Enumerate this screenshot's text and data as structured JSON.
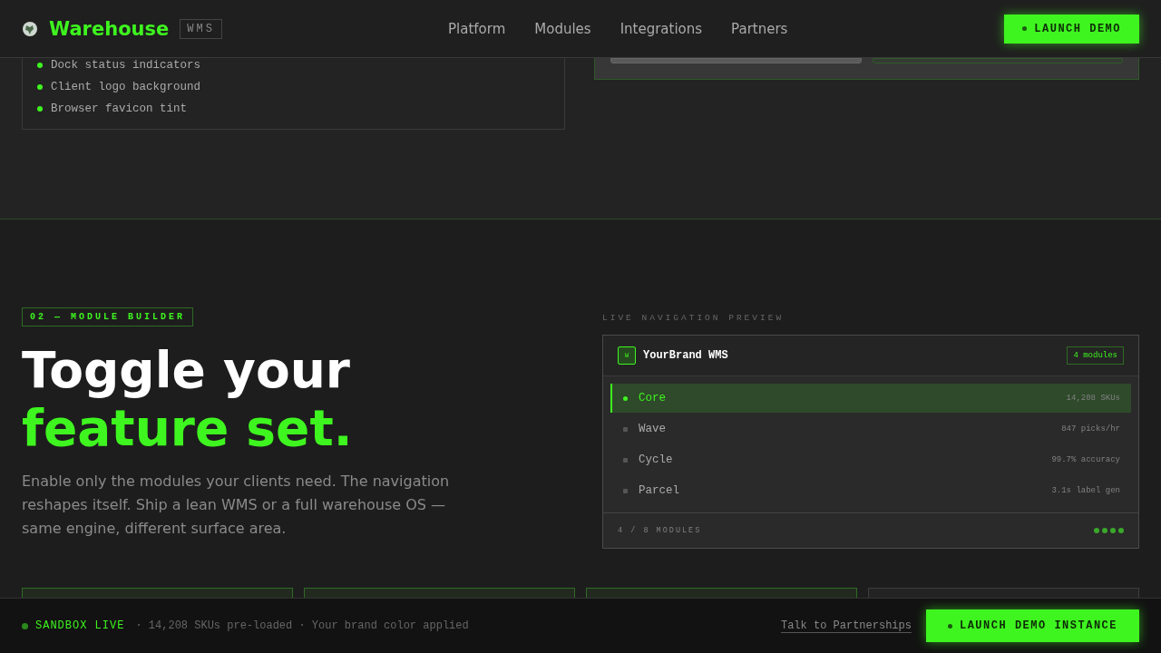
{
  "header": {
    "brand": "Warehouse",
    "badge": "WMS",
    "nav": [
      {
        "label": "Platform"
      },
      {
        "label": "Modules"
      },
      {
        "label": "Integrations"
      },
      {
        "label": "Partners"
      }
    ],
    "cta": "LAUNCH DEMO"
  },
  "previous_section": {
    "list": [
      "Dock status indicators",
      "Client logo background",
      "Browser favicon tint"
    ],
    "swatches": [
      {
        "selected": false
      },
      {
        "selected": true
      }
    ]
  },
  "section": {
    "tag": "02 — MODULE BUILDER",
    "title_line_1": "Toggle your",
    "title_line_2": "feature set.",
    "body": "Enable only the modules your clients need. The navigation reshapes itself. Ship a lean WMS or a full warehouse OS — same engine, different surface area."
  },
  "preview": {
    "label": "LIVE NAVIGATION PREVIEW",
    "logo": "W",
    "app_name": "YourBrand WMS",
    "count_badge": "4 modules",
    "modules": [
      {
        "name": "Core",
        "stat": "14,208 SKUs",
        "selected": true
      },
      {
        "name": "Wave",
        "stat": "847 picks/hr",
        "selected": false
      },
      {
        "name": "Cycle",
        "stat": "99.7% accuracy",
        "selected": false
      },
      {
        "name": "Parcel",
        "stat": "3.1s label gen",
        "selected": false
      }
    ],
    "footer": "4 / 8 MODULES"
  },
  "module_cards": [
    {
      "enabled": true
    },
    {
      "enabled": true
    },
    {
      "enabled": true
    },
    {
      "enabled": false
    }
  ],
  "status_bar": {
    "status": "SANDBOX LIVE",
    "details": "· 14,208 SKUs pre-loaded · Your brand color applied",
    "link": "Talk to Partnerships",
    "cta": "LAUNCH DEMO INSTANCE"
  }
}
